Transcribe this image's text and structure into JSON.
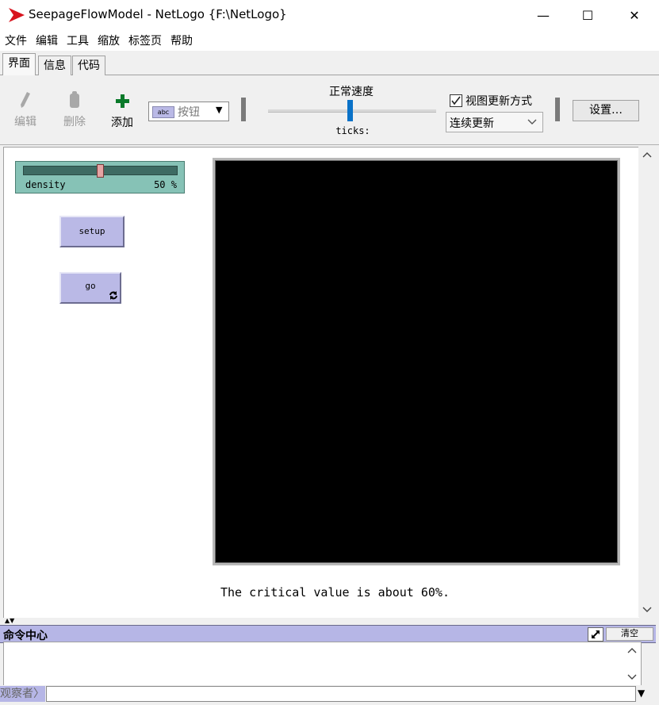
{
  "window": {
    "title": "SeepageFlowModel - NetLogo {F:\\NetLogo}",
    "minimize": "—",
    "maximize": "☐",
    "close": "✕"
  },
  "menu": [
    "文件",
    "编辑",
    "工具",
    "缩放",
    "标签页",
    "帮助"
  ],
  "tabs": [
    "界面",
    "信息",
    "代码"
  ],
  "toolbar": {
    "edit_label": "编辑",
    "delete_label": "删除",
    "add_label": "添加",
    "widget_type": "按钮",
    "speed_label": "正常速度",
    "ticks_label": "ticks:",
    "update_view_label": "视图更新方式",
    "update_mode": "连续更新",
    "settings_label": "设置…"
  },
  "widgets": {
    "slider": {
      "name": "density",
      "value": "50",
      "unit": "%",
      "fraction": 0.5
    },
    "setup_button": "setup",
    "go_button": "go",
    "note": "The critical value is about 60%."
  },
  "command_center": {
    "title": "命令中心",
    "clear_label": "清空",
    "observer_label": "观察者"
  },
  "colors": {
    "slider_bg": "#86c2b6",
    "button_bg": "#bab9e6",
    "command_header_bg": "#b6b6e6",
    "add_green": "#0a7a2a",
    "speed_thumb": "#0a72c8"
  }
}
